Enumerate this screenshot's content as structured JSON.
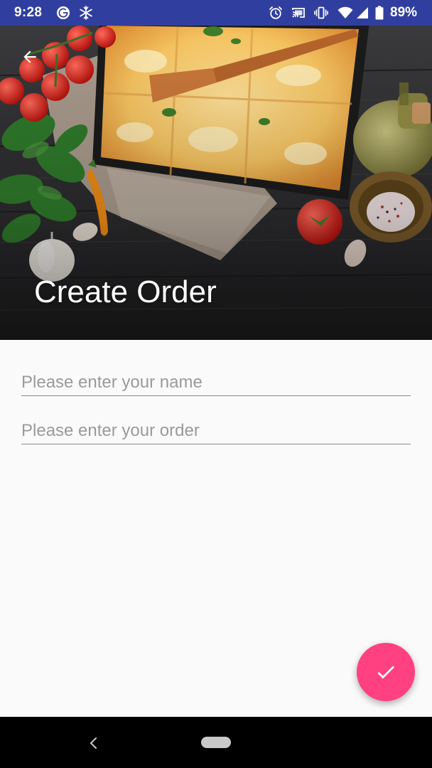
{
  "status_bar": {
    "time": "9:28",
    "battery_percent": "89%",
    "background_color": "#303f9f",
    "icons": [
      "google-g-icon",
      "snowflake-icon",
      "alarm-icon",
      "cast-icon",
      "vibrate-icon",
      "wifi-icon",
      "signal-icon",
      "battery-icon"
    ]
  },
  "header": {
    "title": "Create Order",
    "image": "food-image",
    "back_icon": "arrow-back-icon"
  },
  "form": {
    "name_field": {
      "value": "",
      "placeholder": "Please enter your name"
    },
    "order_field": {
      "value": "",
      "placeholder": "Please enter your order"
    }
  },
  "fab": {
    "icon": "check-icon",
    "color": "#ff4081"
  },
  "nav_bar": {
    "back_icon": "nav-back-icon",
    "home_icon": "nav-home-pill"
  }
}
